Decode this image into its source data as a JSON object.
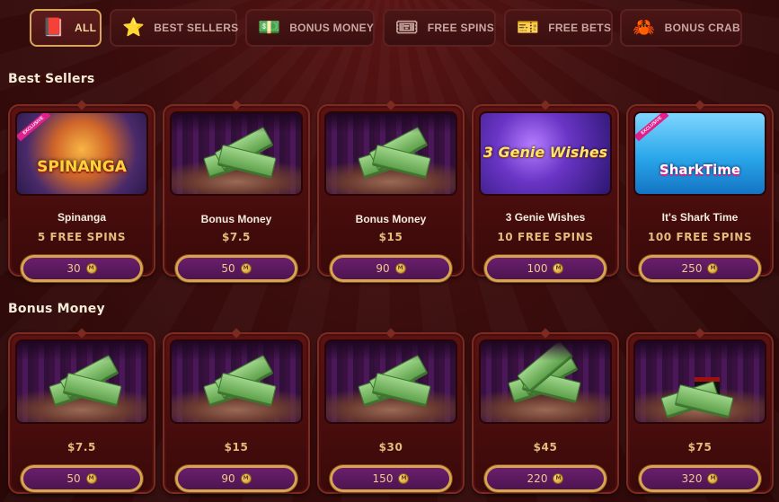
{
  "tabs": [
    {
      "label": "ALL",
      "icon": "book-icon",
      "glyph": "📕",
      "active": true
    },
    {
      "label": "BEST SELLERS",
      "icon": "star-icon",
      "glyph": "⭐",
      "active": false
    },
    {
      "label": "BONUS MONEY",
      "icon": "cash-icon",
      "glyph": "💵",
      "active": false
    },
    {
      "label": "FREE SPINS",
      "icon": "spin-ticket-icon",
      "glyph": "🎟",
      "active": false
    },
    {
      "label": "FREE BETS",
      "icon": "ticket-icon",
      "glyph": "🎫",
      "active": false
    },
    {
      "label": "BONUS CRAB",
      "icon": "crab-icon",
      "glyph": "🦀",
      "active": false
    }
  ],
  "sections": [
    {
      "title": "Best Sellers",
      "cards": [
        {
          "kind": "game",
          "game": "spinanga",
          "art_title": "SPINANGA",
          "badge": "EXCLUSIVE",
          "name": "Spinanga",
          "sub": "5 FREE SPINS",
          "price": "30"
        },
        {
          "kind": "money",
          "name": "Bonus Money",
          "sub": "$7.5",
          "price": "50"
        },
        {
          "kind": "money",
          "name": "Bonus Money",
          "sub": "$15",
          "price": "90"
        },
        {
          "kind": "game",
          "game": "genie",
          "art_title": "3 Genie Wishes",
          "badge": "",
          "name": "3 Genie Wishes",
          "sub": "10 FREE SPINS",
          "price": "100"
        },
        {
          "kind": "game",
          "game": "shark",
          "art_title": "SharkTime",
          "badge": "EXCLUSIVE",
          "name": "It's Shark Time",
          "sub": "100 FREE SPINS",
          "price": "250"
        }
      ]
    },
    {
      "title": "Bonus Money",
      "cards": [
        {
          "kind": "money",
          "name": "",
          "sub": "$7.5",
          "price": "50"
        },
        {
          "kind": "money",
          "name": "",
          "sub": "$15",
          "price": "90"
        },
        {
          "kind": "money",
          "name": "",
          "sub": "$30",
          "price": "150"
        },
        {
          "kind": "money",
          "name": "",
          "sub": "$45",
          "price": "220"
        },
        {
          "kind": "hat",
          "name": "",
          "sub": "$75",
          "price": "320"
        }
      ]
    }
  ],
  "coin_symbol": "M",
  "colors": {
    "accent_gold": "#d9a44f",
    "button_purple": "#5a1a5e",
    "background": "#3b0d0d"
  }
}
